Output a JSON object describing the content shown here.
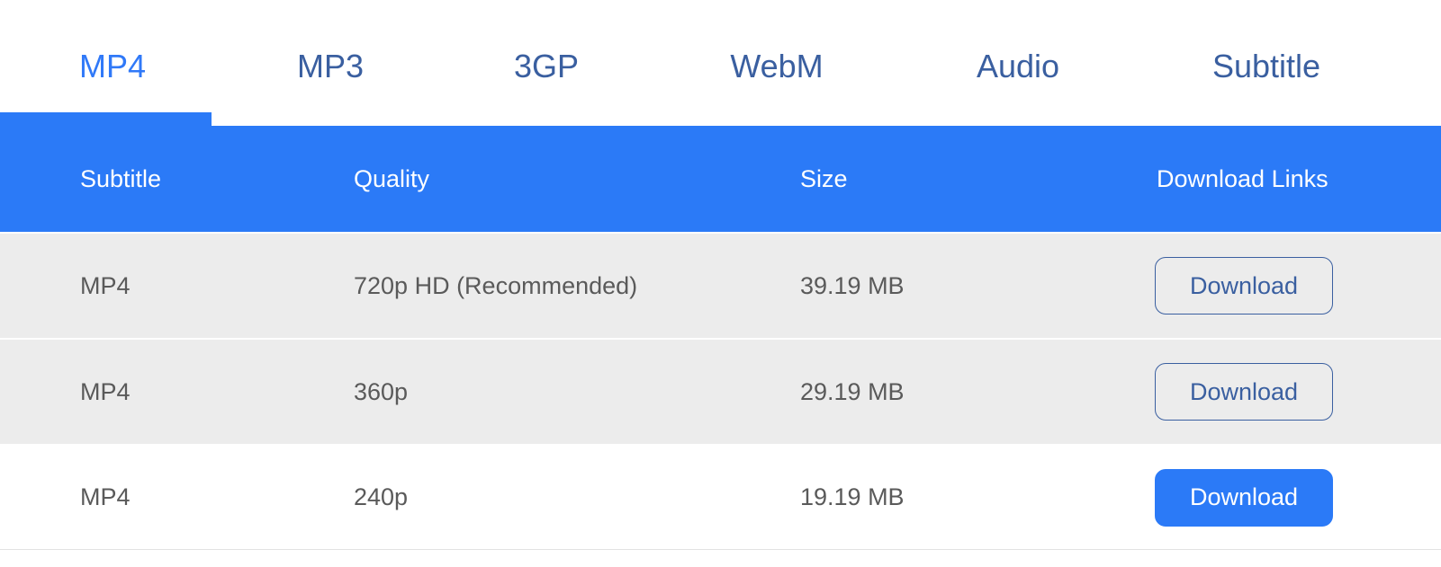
{
  "theme": {
    "accent": "#2b7af7",
    "accent_active_text": "#3079f8",
    "inactive_tab_text": "#3a5fa0",
    "row_bg": "#ececec",
    "row_bg_alt": "#ffffff",
    "body_text": "#5a5a5a",
    "header_text": "#ffffff"
  },
  "tabs": [
    {
      "label": "MP4",
      "active": true
    },
    {
      "label": "MP3",
      "active": false
    },
    {
      "label": "3GP",
      "active": false
    },
    {
      "label": "WebM",
      "active": false
    },
    {
      "label": "Audio",
      "active": false
    },
    {
      "label": "Subtitle",
      "active": false
    }
  ],
  "table": {
    "columns": [
      {
        "key": "subtitle",
        "label": "Subtitle"
      },
      {
        "key": "quality",
        "label": "Quality"
      },
      {
        "key": "size",
        "label": "Size"
      },
      {
        "key": "links",
        "label": "Download Links"
      }
    ],
    "rows": [
      {
        "subtitle": "MP4",
        "quality": "720p HD (Recommended)",
        "size": "39.19 MB",
        "action_label": "Download",
        "action_style": "outline"
      },
      {
        "subtitle": "MP4",
        "quality": "360p",
        "size": "29.19 MB",
        "action_label": "Download",
        "action_style": "outline"
      },
      {
        "subtitle": "MP4",
        "quality": "240p",
        "size": "19.19 MB",
        "action_label": "Download",
        "action_style": "filled"
      }
    ]
  }
}
